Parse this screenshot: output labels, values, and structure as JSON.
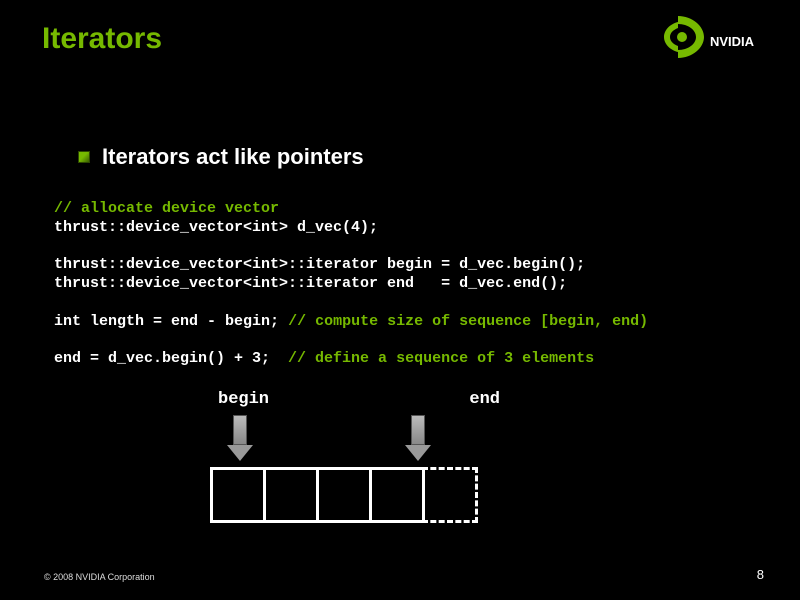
{
  "title": "Iterators",
  "bullet": "Iterators act like pointers",
  "code": {
    "l1": "// allocate device vector",
    "l2a": "thrust::device_vector<int>",
    "l2b": " d_vec(4);",
    "l3a": "thrust::device_vector<int>::iterator begin = d_vec.begin();",
    "l4a": "thrust::device_vector<int>::iterator end   = d_vec.end();",
    "l5a": "int",
    "l5b": " length = end - begin; ",
    "l5c": "// compute size of sequence [begin, end)",
    "l6a": "end = d_vec.begin() + 3;  ",
    "l6b": "// define a sequence of 3 elements"
  },
  "diagram": {
    "label_begin": "begin",
    "label_end": "end"
  },
  "footer": {
    "copyright": "© 2008 NVIDIA Corporation",
    "page": "8"
  },
  "logo_text": "NVIDIA"
}
